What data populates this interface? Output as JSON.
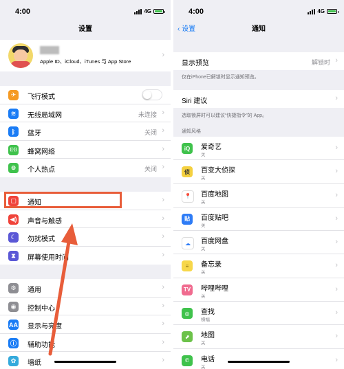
{
  "status": {
    "time": "4:00",
    "network": "4G"
  },
  "left": {
    "title": "设置",
    "profile": {
      "subtitle": "Apple ID、iCloud、iTunes 与 App Store"
    },
    "group1": [
      {
        "label": "飞行模式",
        "icon": "airplane-icon",
        "color": "#f59a23",
        "toggle": true
      },
      {
        "label": "无线局域网",
        "icon": "wifi-icon",
        "color": "#1a7cf5",
        "value": "未连接"
      },
      {
        "label": "蓝牙",
        "icon": "bluetooth-icon",
        "color": "#1a7cf5",
        "value": "关闭"
      },
      {
        "label": "蜂窝网络",
        "icon": "cellular-icon",
        "color": "#3fc24c",
        "value": ""
      },
      {
        "label": "个人热点",
        "icon": "hotspot-icon",
        "color": "#3fc24c",
        "value": "关闭"
      }
    ],
    "group2": [
      {
        "label": "通知",
        "icon": "notification-icon",
        "color": "#f0433a"
      },
      {
        "label": "声音与触感",
        "icon": "sound-icon",
        "color": "#f0433a"
      },
      {
        "label": "勿扰模式",
        "icon": "moon-icon",
        "color": "#5b58d6"
      },
      {
        "label": "屏幕使用时间",
        "icon": "hourglass-icon",
        "color": "#5b58d6"
      }
    ],
    "group3": [
      {
        "label": "通用",
        "icon": "gear-icon",
        "color": "#8e8e93"
      },
      {
        "label": "控制中心",
        "icon": "control-center-icon",
        "color": "#8e8e93"
      },
      {
        "label": "显示与亮度",
        "icon": "display-icon",
        "color": "#1a7cf5"
      },
      {
        "label": "辅助功能",
        "icon": "accessibility-icon",
        "color": "#1a7cf5"
      },
      {
        "label": "墙纸",
        "icon": "wallpaper-icon",
        "color": "#35aadc"
      }
    ]
  },
  "right": {
    "back": "设置",
    "title": "通知",
    "preview": {
      "label": "显示预览",
      "value": "解锁时"
    },
    "preview_note": "仅在iPhone已解锁时显示通知预览。",
    "siri": {
      "label": "Siri 建议"
    },
    "siri_note": "选取锁屏时可以建议“快捷指令”的 App。",
    "style_header": "通知风格",
    "apps": [
      {
        "name": "爱奇艺",
        "sub": "关",
        "icon": "iqiyi-icon",
        "color": "#3fc24c",
        "glyph": "iQ"
      },
      {
        "name": "百变大侦探",
        "sub": "关",
        "icon": "detective-icon",
        "color": "#f4d03f",
        "glyph": "侦"
      },
      {
        "name": "百度地图",
        "sub": "关",
        "icon": "baidu-map-icon",
        "color": "#ffffff",
        "glyph": "📍"
      },
      {
        "name": "百度贴吧",
        "sub": "关",
        "icon": "tieba-icon",
        "color": "#2e7cf6",
        "glyph": "贴"
      },
      {
        "name": "百度网盘",
        "sub": "关",
        "icon": "baidu-netdisk-icon",
        "color": "#ffffff",
        "glyph": "☁"
      },
      {
        "name": "备忘录",
        "sub": "关",
        "icon": "notes-icon",
        "color": "#f7d74a",
        "glyph": "≡"
      },
      {
        "name": "哔哩哔哩",
        "sub": "关",
        "icon": "bilibili-icon",
        "color": "#f06b8f",
        "glyph": "TV"
      },
      {
        "name": "查找",
        "sub": "横幅",
        "icon": "find-my-icon",
        "color": "#3fc24c",
        "glyph": "◎"
      },
      {
        "name": "地图",
        "sub": "关",
        "icon": "maps-icon",
        "color": "#6cc24a",
        "glyph": "⬈"
      },
      {
        "name": "电话",
        "sub": "关",
        "icon": "phone-icon",
        "color": "#3fc24c",
        "glyph": "✆"
      }
    ]
  },
  "colors": {
    "accent": "#1a7cf5",
    "highlight": "#e85d3a",
    "background": "#efeff4"
  }
}
